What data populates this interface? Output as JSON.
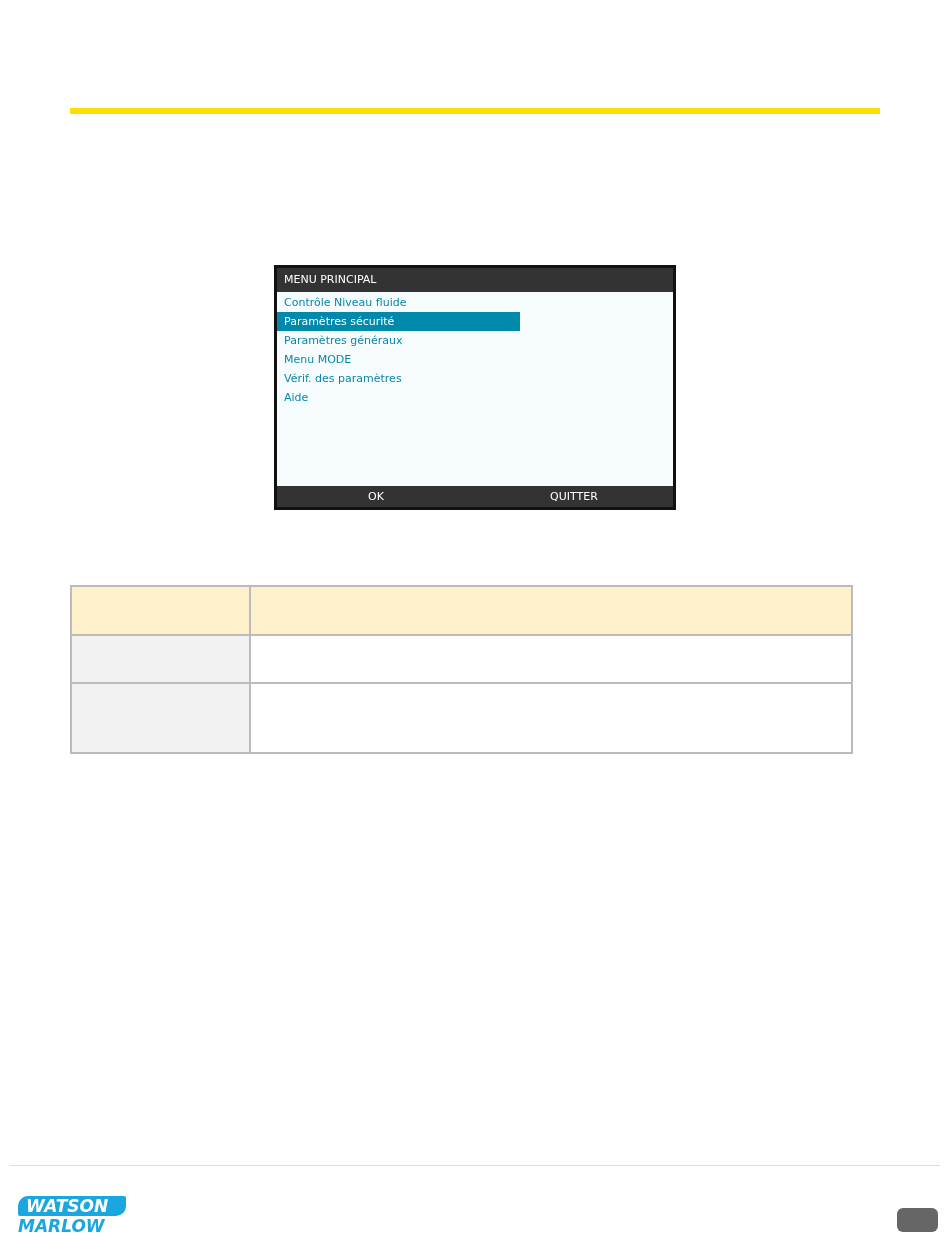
{
  "screen": {
    "title": "MENU PRINCIPAL",
    "items": [
      {
        "label": "Contrôle Niveau fluide",
        "selected": false
      },
      {
        "label": "Paramètres sécurité",
        "selected": true
      },
      {
        "label": "Paramètres généraux",
        "selected": false
      },
      {
        "label": "Menu MODE",
        "selected": false
      },
      {
        "label": "Vérif. des paramètres",
        "selected": false
      },
      {
        "label": "Aide",
        "selected": false
      }
    ],
    "softkeys": [
      "OK",
      "QUITTER"
    ]
  },
  "table": {
    "rows": [
      {
        "kind": "header"
      },
      {
        "kind": "body"
      },
      {
        "kind": "tall"
      }
    ]
  },
  "footer": {
    "logo": [
      "WATSON",
      "MARLOW"
    ]
  }
}
